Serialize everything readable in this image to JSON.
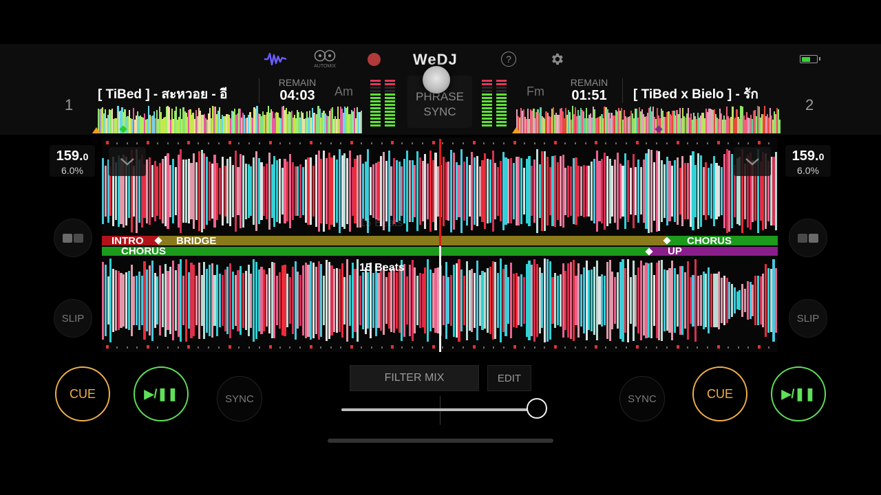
{
  "app": {
    "title": "WeDJ"
  },
  "toolbar": {
    "waveform_icon": "waveform-icon",
    "automix_label": "AUTOMIX",
    "record_icon": "record-icon",
    "help_label": "?",
    "settings_icon": "gear-icon",
    "battery_icon": "battery-icon"
  },
  "deck1": {
    "number": "1",
    "title": "[ TiBed ] - สะหวอย - อี",
    "remain_label": "REMAIN",
    "remain_time": "04:03",
    "key": "Am",
    "bpm_main": "159.",
    "bpm_decimal": "0",
    "pitch": "6.0%",
    "cue_label": "CUE",
    "play_label": "▶/❚❚",
    "sync_label": "SYNC",
    "slip_label": "SLIP"
  },
  "deck2": {
    "number": "2",
    "title": "[ TiBed x Bielo  ] - รัก",
    "remain_label": "REMAIN",
    "remain_time": "01:51",
    "key": "Fm",
    "bpm_main": "159.",
    "bpm_decimal": "0",
    "pitch": "6.0%",
    "cue_label": "CUE",
    "play_label": "▶/❚❚",
    "sync_label": "SYNC",
    "slip_label": "SLIP"
  },
  "center": {
    "phrase_sync_line1": "PHRASE",
    "phrase_sync_line2": "SYNC",
    "filter_mix_label": "FILTER MIX",
    "edit_label": "EDIT",
    "crossfader_position": 1.0
  },
  "phrases": {
    "top": [
      {
        "label": "INTRO",
        "color": "#b3121a"
      },
      {
        "label": "BRIDGE",
        "color": "#8a7a1c"
      },
      {
        "label": "CHORUS",
        "color": "#1c9a1c"
      }
    ],
    "bottom": [
      {
        "label": "CHORUS",
        "color": "#1c9a1c"
      },
      {
        "label": "UP",
        "color": "#8a1e8a"
      }
    ]
  },
  "beats": {
    "top_ghost": "15 Beats",
    "bottom": "15 Beats"
  },
  "colors": {
    "cue": "#f0b04c",
    "play": "#5fe05a",
    "automix_purple": "#6b5cff",
    "record": "#b23a3a",
    "playhead_top": "#e01a1a"
  }
}
